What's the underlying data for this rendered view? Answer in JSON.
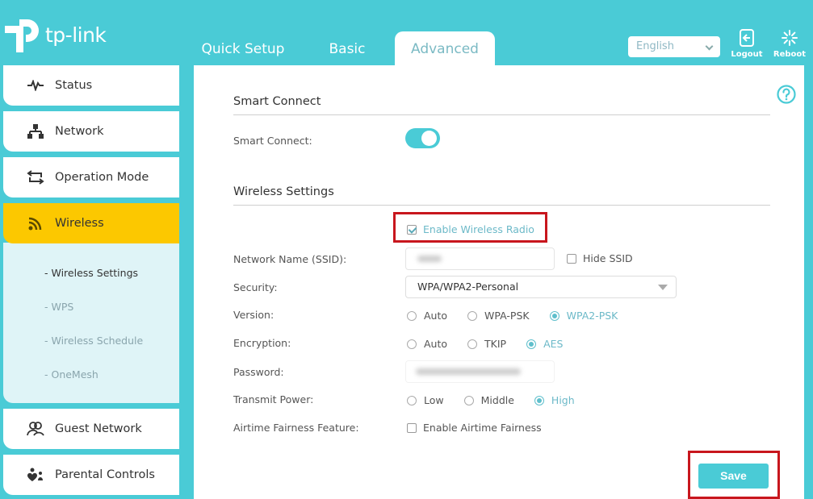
{
  "header": {
    "brand": "tp-link",
    "tabs": [
      {
        "label": "Quick Setup",
        "active": false
      },
      {
        "label": "Basic",
        "active": false
      },
      {
        "label": "Advanced",
        "active": true
      }
    ],
    "language": {
      "selected": "English",
      "icon": "chevron-down-icon"
    },
    "logout_label": "Logout",
    "reboot_label": "Reboot"
  },
  "sidebar": {
    "items": [
      {
        "label": "Status",
        "icon": "pulse-icon"
      },
      {
        "label": "Network",
        "icon": "network-tree-icon"
      },
      {
        "label": "Operation Mode",
        "icon": "swap-arrows-icon"
      },
      {
        "label": "Wireless",
        "icon": "wifi-icon",
        "active": true
      },
      {
        "label": "Guest Network",
        "icon": "guests-icon"
      },
      {
        "label": "Parental Controls",
        "icon": "parental-icon"
      }
    ],
    "wireless_submenu": [
      {
        "label": "- Wireless Settings",
        "active": true
      },
      {
        "label": "- WPS",
        "active": false
      },
      {
        "label": "- Wireless Schedule",
        "active": false
      },
      {
        "label": "- OneMesh",
        "active": false
      }
    ]
  },
  "main": {
    "help_icon": "question-circle-icon",
    "smart_connect": {
      "section_title": "Smart Connect",
      "label": "Smart Connect:",
      "enabled": true
    },
    "wireless_settings": {
      "section_title": "Wireless Settings",
      "enable_radio": {
        "label": "Enable Wireless Radio",
        "checked": true
      },
      "ssid": {
        "label": "Network Name (SSID):",
        "value_blurred": true
      },
      "hide_ssid": {
        "label": "Hide SSID",
        "checked": false
      },
      "security": {
        "label": "Security:",
        "selected": "WPA/WPA2-Personal"
      },
      "version": {
        "label": "Version:",
        "options": [
          "Auto",
          "WPA-PSK",
          "WPA2-PSK"
        ],
        "selected": "WPA2-PSK"
      },
      "encryption": {
        "label": "Encryption:",
        "options": [
          "Auto",
          "TKIP",
          "AES"
        ],
        "selected": "AES"
      },
      "password": {
        "label": "Password:",
        "value_blurred": true
      },
      "transmit_power": {
        "label": "Transmit Power:",
        "options": [
          "Low",
          "Middle",
          "High"
        ],
        "selected": "High"
      },
      "airtime": {
        "label": "Airtime Fairness Feature:",
        "checkbox_label": "Enable Airtime Fairness",
        "checked": false
      }
    },
    "save_label": "Save"
  },
  "colors": {
    "brand_teal": "#4acbd6",
    "active_menu": "#fcc800",
    "submenu_bg": "#dff4f7",
    "highlight_red": "#c8161d"
  }
}
